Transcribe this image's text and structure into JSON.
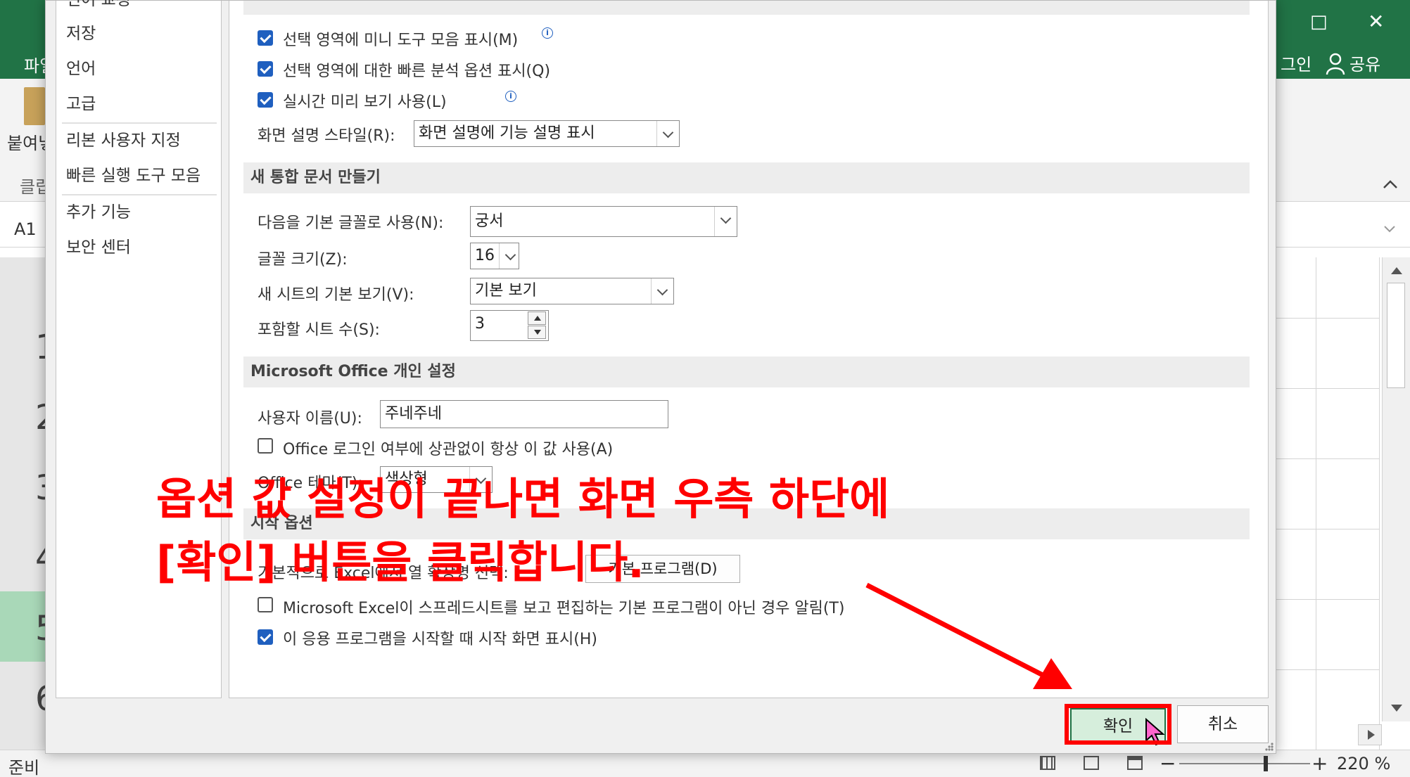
{
  "excel": {
    "tab_file_partial": "파일",
    "signin_partial": "그인",
    "share_label": "공유",
    "paste_partial": "붙여넣",
    "clipboard_partial": "클립",
    "name_box": "A1",
    "row_numbers": [
      "1",
      "2",
      "3",
      "4",
      "5",
      "6"
    ],
    "status_ready": "준비",
    "zoom_level": "220 %"
  },
  "dialog": {
    "nav": {
      "items": [
        {
          "label": "언어 교정"
        },
        {
          "label": "저장"
        },
        {
          "label": "언어"
        },
        {
          "label": "고급"
        },
        {
          "label": "리본 사용자 지정"
        },
        {
          "label": "빠른 실행 도구 모음"
        },
        {
          "label": "추가 기능"
        },
        {
          "label": "보안 센터"
        }
      ]
    },
    "ui_options": {
      "mini_toolbar_label": "선택 영역에 미니 도구 모음 표시(M)",
      "quick_analysis_label": "선택 영역에 대한 빠른 분석 옵션 표시(Q)",
      "live_preview_label": "실시간 미리 보기 사용(L)",
      "screentip_label": "화면 설명 스타일(R):",
      "screentip_value": "화면 설명에 기능 설명 표시",
      "info_glyph": "i"
    },
    "new_workbook": {
      "heading": "새 통합 문서 만들기",
      "font_label": "다음을 기본 글꼴로 사용(N):",
      "font_value": "궁서",
      "size_label": "글꼴 크기(Z):",
      "size_value": "16",
      "view_label": "새 시트의 기본 보기(V):",
      "view_value": "기본 보기",
      "sheets_label": "포함할 시트 수(S):",
      "sheets_value": "3"
    },
    "personalize": {
      "heading": "Microsoft Office 개인 설정",
      "username_label": "사용자 이름(U):",
      "username_value": "주네주네",
      "always_use_label": "Office 로그인 여부에 상관없이 항상 이 값 사용(A)",
      "theme_label": "Office 테마(T):",
      "theme_value": "색상형"
    },
    "startup": {
      "heading": "시작 옵션",
      "default_program_partial": "기본적으로 Excel에서 열 확장명 선택:",
      "default_program_button": "기본 프로그램(D)",
      "notify_label": "Microsoft Excel이 스프레드시트를 보고 편집하는 기본 프로그램이 아닌 경우 알림(T)",
      "start_screen_label": "이 응용 프로그램을 시작할 때 시작 화면 표시(H)"
    },
    "checkboxes": {
      "mini_toolbar": true,
      "quick_analysis": true,
      "live_preview": true,
      "always_use": false,
      "notify": false,
      "start_screen": true
    },
    "ok_label": "확인",
    "cancel_label": "취소"
  },
  "annotation": {
    "line1": "옵션 값 설정이 끝나면 화면 우측 하단에",
    "line2": "[확인] 버튼을 클릭합니다.",
    "color": "#ff0000"
  },
  "colors": {
    "excel_green": "#217346",
    "checkbox_blue": "#1f5fbf",
    "highlight_red": "#ff0000"
  }
}
